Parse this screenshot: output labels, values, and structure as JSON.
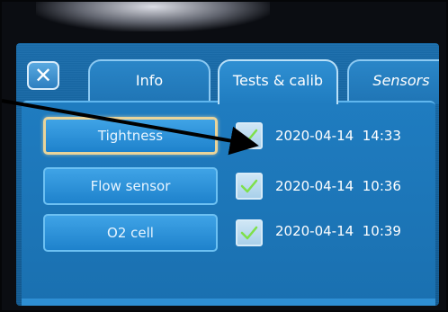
{
  "window": {
    "close_symbol": "✕"
  },
  "tabs": [
    {
      "label": "Info",
      "active": false
    },
    {
      "label": "Tests & calib",
      "active": true
    },
    {
      "label": "Sensors",
      "active": false
    }
  ],
  "tests": [
    {
      "label": "Tightness",
      "selected": true,
      "checked": true,
      "date": "2020-04-14",
      "time": "14:33"
    },
    {
      "label": "Flow sensor",
      "selected": false,
      "checked": true,
      "date": "2020-04-14",
      "time": "10:36"
    },
    {
      "label": "O2 cell",
      "selected": false,
      "checked": true,
      "date": "2020-04-14",
      "time": "10:39"
    }
  ],
  "colors": {
    "screen_bg": "#1a70b0",
    "accent": "#6cc0f2",
    "selected_border": "#e9d49a",
    "check_green": "#7ee04a",
    "annotation_arrow": "#000000"
  },
  "icons": {
    "close": "close-icon",
    "check": "checkmark-icon"
  }
}
